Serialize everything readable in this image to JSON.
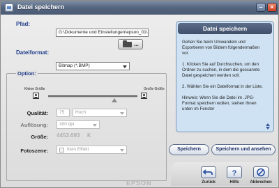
{
  "window": {
    "title": "Datei speichern",
    "min_symbol": "–",
    "close_symbol": "×"
  },
  "path": {
    "label": "Pfad:",
    "value": "G:\\Dokumente und Einstellungen\\epson_01\\"
  },
  "browse_button": {
    "label": "..."
  },
  "format": {
    "label": "Dateiformat:",
    "value": "Bitmap (*.BMP)"
  },
  "options": {
    "title": "Option:",
    "small_size_label": "Kleine Größe",
    "large_size_label": "Große Größe",
    "quality_label": "Qualität:",
    "quality_value": "75",
    "quality_select": "Hoch",
    "resolution_label": "Auflösung:",
    "resolution_value": "300 dpi",
    "size_label": "Größe:",
    "size_value": "4453.693",
    "size_unit": "K",
    "photoscene_label": "Fotoszene:",
    "photoscene_value": "Kein Effekt"
  },
  "help": {
    "title": "Datei speichern",
    "p1": "Gehen Sie beim Umwandeln und Exportieren von Bildern folgendermaßen vor.",
    "p2": "1. Klicken Sie auf Durchsuchen, um den Ordner zu suchen, in dem die gescannte Datei gespeichert werden soll.",
    "p3": "2. Wählen Sie ein Dateiformat in der Liste.",
    "p4": "Hinweis: Wenn Sie die Datei im .JPG-Format speichern wollen, stehen Ihnen unten im Fenster"
  },
  "buttons": {
    "save": "Speichern",
    "save_view": "Speichern und ansehen",
    "back": "Zurück",
    "help": "Hilfe",
    "cancel": "Abbrechen"
  },
  "brand": "EPSON",
  "colors": {
    "title_bar": "#556580",
    "help_panel": "#cfe2f3",
    "label_blue": "#1f3d8a"
  }
}
